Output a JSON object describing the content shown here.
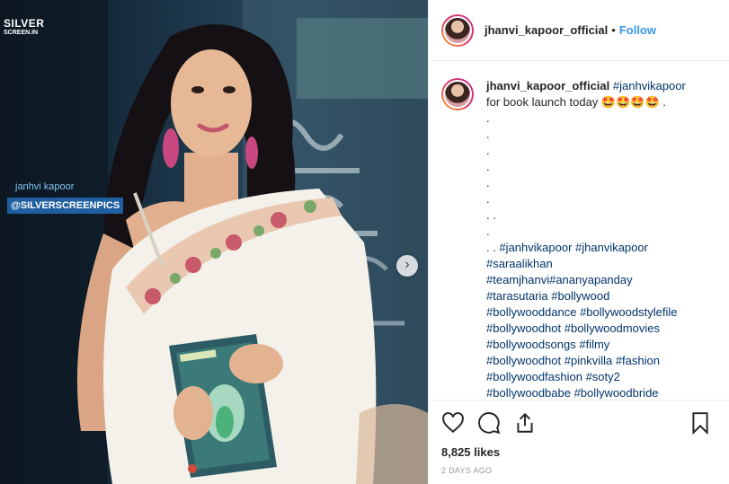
{
  "post": {
    "username": "jhanvi_kapoor_official",
    "follow_label": "Follow",
    "separator": "•",
    "likes": "8,825 likes",
    "timestamp": "2 DAYS AGO"
  },
  "photo": {
    "watermark_logo_top": "SILVER",
    "watermark_logo_bottom": "SCREEN.IN",
    "watermark_name": "janhvi kapoor",
    "watermark_handle": "@SILVERSCREENPICS",
    "next_label": "›"
  },
  "caption": {
    "username": "jhanvi_kapoor_official",
    "first_tag": "#janhvikapoor",
    "text": "for book launch today 🤩🤩🤩🤩 .",
    "dots": [
      ".",
      ".",
      ".",
      ".",
      ".",
      ".",
      ". .",
      "."
    ],
    "tags_line1_prefix": ". . ",
    "tags_line1": "#janhvikapoor #jhanvikapoor",
    "tag_lines": [
      "#saraalikhan",
      "#teamjhanvi#ananyapanday",
      "#tarasutaria #bollywood",
      "#bollywooddance #bollywoodstylefile",
      "#bollywoodhot #bollywoodmovies",
      "#bollywoodsongs #filmy",
      "#bollywoodhot #pinkvilla #fashion",
      "#bollywoodfashion #soty2",
      "#bollywoodbabe #bollywoodbride"
    ]
  },
  "icons": {
    "like": "heart-icon",
    "comment": "comment-icon",
    "share": "share-icon",
    "save": "bookmark-icon"
  },
  "colors": {
    "link": "#3897f0",
    "hashtag": "#003569",
    "text": "#262626",
    "muted": "#999999"
  }
}
